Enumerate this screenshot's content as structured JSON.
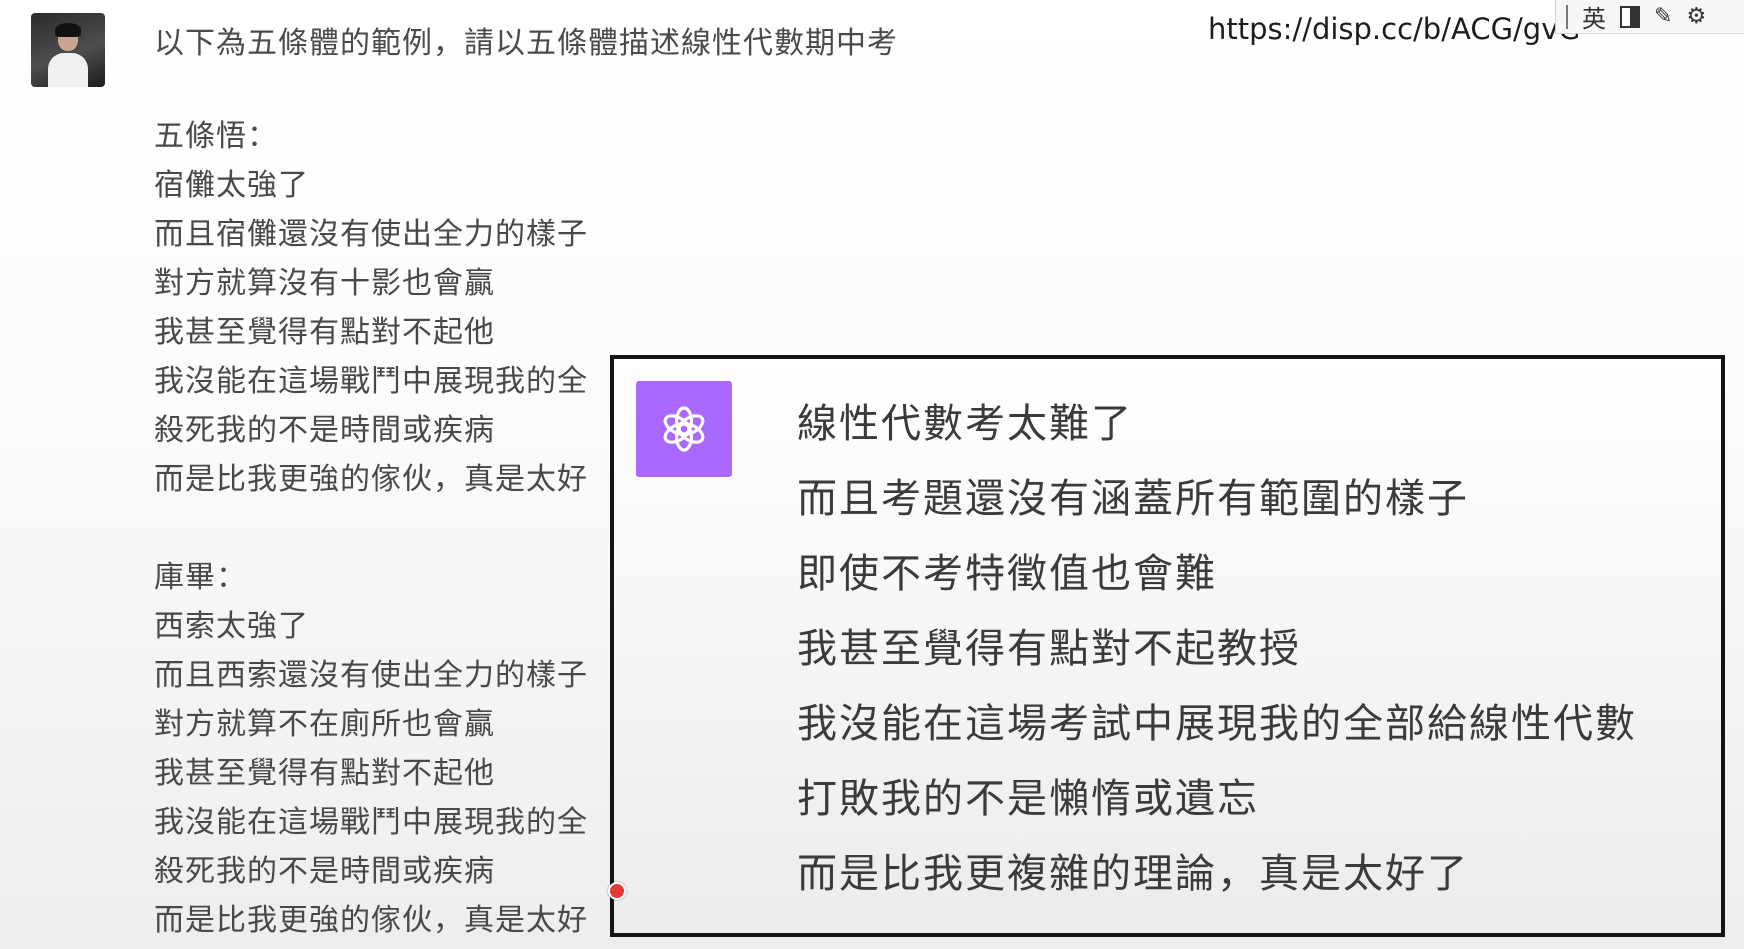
{
  "browser": {
    "url": "https://disp.cc/b/ACG/gvG"
  },
  "ime_toolbar": {
    "mode_label": "英",
    "icons": [
      "text-cursor-icon",
      "half-width-icon",
      "tools-icon",
      "gear-icon"
    ]
  },
  "user_message": {
    "prompt": "以下為五條體的範例，請以五條體描述線性代數期中考",
    "example1": {
      "title": "五條悟：",
      "lines": [
        "宿儺太強了",
        "而且宿儺還沒有使出全力的樣子",
        "對方就算沒有十影也會贏",
        "我甚至覺得有點對不起他",
        "我沒能在這場戰鬥中展現我的全",
        "殺死我的不是時間或疾病",
        "而是比我更強的傢伙，真是太好"
      ]
    },
    "example2": {
      "title": "庫畢：",
      "lines": [
        "西索太強了",
        "而且西索還沒有使出全力的樣子",
        "對方就算不在廁所也會贏",
        "我甚至覺得有點對不起他",
        "我沒能在這場戰鬥中展現我的全",
        "殺死我的不是時間或疾病",
        "而是比我更強的傢伙，真是太好"
      ]
    }
  },
  "assistant_response": {
    "logo_color": "#ab68ff",
    "lines": [
      "線性代數考太難了",
      "而且考題還沒有涵蓋所有範圍的樣子",
      "即使不考特徵值也會難",
      "我甚至覺得有點對不起教授",
      "我沒能在這場考試中展現我的全部給線性代數",
      "打敗我的不是懶惰或遺忘",
      "而是比我更複雜的理論，真是太好了"
    ]
  }
}
